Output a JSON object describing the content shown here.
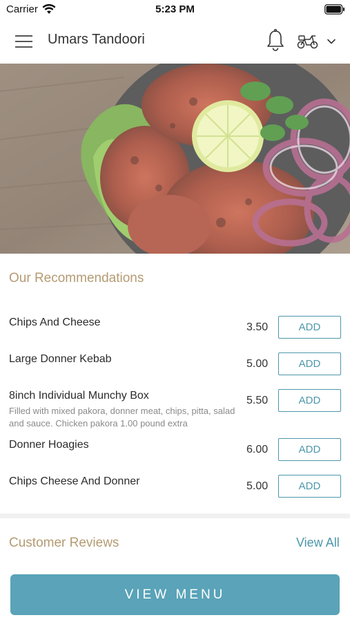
{
  "status_bar": {
    "carrier": "Carrier",
    "time": "5:23 PM"
  },
  "header": {
    "title": "Umars Tandoori"
  },
  "hero": {
    "image": "tandoori-chicken-photo"
  },
  "recommendations": {
    "title": "Our Recommendations",
    "items": [
      {
        "name": "Chips And Cheese",
        "description": "",
        "price": "3.50",
        "action": "ADD"
      },
      {
        "name": "Large Donner Kebab",
        "description": "",
        "price": "5.00",
        "action": "ADD"
      },
      {
        "name": "8inch Individual Munchy Box",
        "description": "Filled with mixed pakora, donner meat, chips, pitta, salad and sauce. Chicken pakora 1.00 pound extra",
        "price": "5.50",
        "action": "ADD"
      },
      {
        "name": "Donner Hoagies",
        "description": "",
        "price": "6.00",
        "action": "ADD"
      },
      {
        "name": "Chips Cheese And Donner",
        "description": "",
        "price": "5.00",
        "action": "ADD"
      }
    ]
  },
  "reviews": {
    "title": "Customer Reviews",
    "view_all": "View All"
  },
  "footer": {
    "view_menu": "VIEW MENU"
  },
  "colors": {
    "accent": "#4d97ab",
    "section_title": "#b49b73",
    "button_fill": "#5aa3b8"
  }
}
